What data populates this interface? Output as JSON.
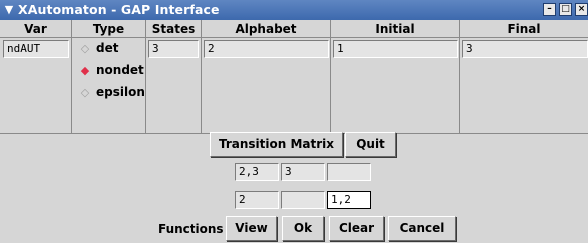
{
  "window": {
    "title": "XAutomaton - GAP Interface",
    "menu_icon": "chevron-down-icon",
    "minimize_icon": "minimize-icon",
    "maximize_icon": "maximize-icon",
    "close_icon": "close-icon"
  },
  "table": {
    "headers": {
      "var": "Var",
      "type": "Type",
      "states": "States",
      "alphabet": "Alphabet",
      "initial": "Initial",
      "final": "Final"
    },
    "row": {
      "var": "ndAUT",
      "states": "3",
      "alphabet": "2",
      "initial": "1",
      "final": "3"
    },
    "type_options": [
      {
        "label": "det",
        "selected": false
      },
      {
        "label": "nondet",
        "selected": true
      },
      {
        "label": "epsilon",
        "selected": false
      }
    ]
  },
  "buttons": {
    "transition_matrix": "Transition Matrix",
    "quit": "Quit"
  },
  "matrix": {
    "rows": [
      [
        "2,3",
        "3",
        ""
      ],
      [
        "2",
        "",
        "1,2"
      ]
    ],
    "active_cell": [
      1,
      2
    ]
  },
  "functions": {
    "label": "Functions",
    "view": "View",
    "ok": "Ok",
    "clear": "Clear",
    "cancel": "Cancel"
  }
}
